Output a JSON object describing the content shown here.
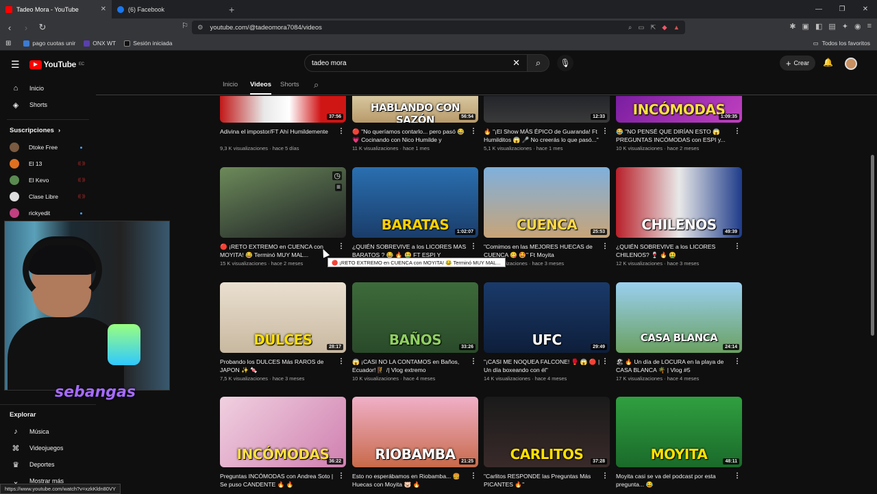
{
  "browser": {
    "tabs": [
      {
        "title": "Tadeo Mora - YouTube",
        "fav_color": "#ff0000",
        "active": true
      },
      {
        "title": "(6) Facebook",
        "fav_color": "#1877f2",
        "active": false
      }
    ],
    "url": "youtube.com/@tadeomora7084/videos",
    "bookmarks": [
      {
        "label": "pago cuotas unir"
      },
      {
        "label": "ONX WT"
      },
      {
        "label": "Sesión iniciada"
      }
    ],
    "favorites_label": "Todos los favoritos",
    "status_url": "https://www.youtube.com/watch?v=xzkKldn80VY"
  },
  "header": {
    "logo_text": "YouTube",
    "logo_region": "EC",
    "search_value": "tadeo mora",
    "create_label": "Crear"
  },
  "sidebar": {
    "top": [
      {
        "label": "Inicio",
        "icon": "home-icon",
        "glyph": "⌂"
      },
      {
        "label": "Shorts",
        "icon": "shorts-icon",
        "glyph": "◈"
      }
    ],
    "subs_heading": "Suscripciones",
    "subs": [
      {
        "label": "Dtoke Free",
        "color": "#7a5a40",
        "status": "dot"
      },
      {
        "label": "El 13",
        "color": "#e07020",
        "status": "live"
      },
      {
        "label": "El Kevo",
        "color": "#5a8a50",
        "status": "live"
      },
      {
        "label": "Clase Libre",
        "color": "#dddddd",
        "status": "live"
      },
      {
        "label": "rickyedit",
        "color": "#c04080",
        "status": "dot"
      }
    ],
    "explore_heading": "Explorar",
    "explore": [
      {
        "label": "Música",
        "icon": "music-icon",
        "glyph": "♪"
      },
      {
        "label": "Videojuegos",
        "icon": "gamepad-icon",
        "glyph": "⌘"
      },
      {
        "label": "Deportes",
        "icon": "trophy-icon",
        "glyph": "♛"
      },
      {
        "label": "Mostrar más",
        "icon": "chevron-down-icon",
        "glyph": "⌄"
      }
    ]
  },
  "channel_tabs": [
    "Inicio",
    "Videos",
    "Shorts"
  ],
  "selected_tab": "Videos",
  "overlay": {
    "streamer_tag": "sebangas",
    "tooltip": "🔴 ¡RETO EXTREMO en CUENCA con MOYITA! 😂 Terminó MUY MAL..."
  },
  "videos": [
    {
      "title": "Adivina el impostor/FT Ahí Humildemente",
      "meta": "9,3 K visualizaciones · hace 5 días",
      "duration": "37:56",
      "bg": "linear-gradient(90deg,#c21818 0,#e8e8e8 35%,#fff 55%,#d01515 80%)",
      "overlay_text": "",
      "text_color": "#fff"
    },
    {
      "title": "🔴 \"No queríamos contarlo... pero pasó 😂 💗 Cocinando con Nico Humilde y habland...",
      "meta": "11 K visualizaciones · hace 1 mes",
      "duration": "56:54",
      "bg": "linear-gradient(180deg,#d7c7a0,#b89a6a)",
      "overlay_text": "HABLANDO CON SAZÓN",
      "text_color": "#ffffff"
    },
    {
      "title": "🔥 \"¡El Show MÁS ÉPICO de Guaranda! Ft Humilditos 😱 🎤 No creerás lo que pasó...\"",
      "meta": "5,1 K visualizaciones · hace 1 mes",
      "duration": "12:33",
      "bg": "linear-gradient(180deg,#23252a,#3a3a3a)",
      "overlay_text": "",
      "text_color": "#fff"
    },
    {
      "title": "😂 \"NO PENSÉ QUE DIRÍAN ESTO 😱 PREGUNTAS INCÓMODAS con ESPI y...",
      "meta": "10 K visualizaciones · hace 2 meses",
      "duration": "1:09:35",
      "bg": "linear-gradient(135deg,#7a1ea0,#c040c0)",
      "overlay_text": "INCÓMODAS",
      "text_color": "#ffe040"
    },
    {
      "title": "🔴 ¡RETO EXTREMO en CUENCA con MOYITA! 😂 Terminó MUY MAL...",
      "meta": "15 K visualizaciones · hace 2 meses",
      "duration": "",
      "bg": "linear-gradient(160deg,#6d8a5a,#3c4a3a 60%,#222)",
      "overlay_text": "",
      "text_color": "#fff"
    },
    {
      "title": "¿QUIÉN SOBREVIVE a los LICORES MAS BARATOS ? 😂 🔥 🤮 FT ESPI Y FALCONE",
      "meta": "12 K visualizaciones · hace 3 meses",
      "duration": "1:02:07",
      "bg": "linear-gradient(180deg,#2a6fb0,#1a3d6a)",
      "overlay_text": "BARATAS",
      "text_color": "#ffd000"
    },
    {
      "title": "\"Comimos en las MEJORES HUECAS de CUENCA 😋 🤩\" Ft Moyita",
      "meta": "9 K visualizaciones · hace 3 meses",
      "duration": "25:53",
      "bg": "linear-gradient(180deg,#7fb0dc,#c8a478)",
      "overlay_text": "CUENCA",
      "text_color": "#ffd84a"
    },
    {
      "title": "¿QUIÉN SOBREVIVE a los LICORES CHILENOS? 🍷 🔥 🤮",
      "meta": "12 K visualizaciones · hace 3 meses",
      "duration": "49:39",
      "bg": "linear-gradient(90deg,#b8202a,#e8e8e8 50%,#1f3c8a)",
      "overlay_text": "CHILENOS",
      "text_color": "#ffffff"
    },
    {
      "title": "Probando los DULCES Más RAROS de JAPON ✨ 🍬",
      "meta": "7,5 K visualizaciones · hace 3 meses",
      "duration": "28:17",
      "bg": "linear-gradient(180deg,#eae0d0,#c8b8a0)",
      "overlay_text": "DULCES",
      "text_color": "#ffe000"
    },
    {
      "title": "😱 ¡CASI NO LA CONTAMOS en Baños, Ecuador! 🧗 /| Vlog extremo",
      "meta": "10 K visualizaciones · hace 4 meses",
      "duration": "33:26",
      "bg": "linear-gradient(180deg,#3d6b3a,#2a4a2a)",
      "overlay_text": "BAÑOS",
      "text_color": "#90d060"
    },
    {
      "title": "\"¡CASI ME NOQUEA FALCONE! 🥊 😱 🔴 | Un día boxeando con él\"",
      "meta": "14 K visualizaciones · hace 4 meses",
      "duration": "29:49",
      "bg": "linear-gradient(180deg,#1a3a6a,#0e1e3a)",
      "overlay_text": "UFC",
      "text_color": "#ffffff"
    },
    {
      "title": "🏖 🔥 Un día de LOCURA en la playa de CASA BLANCA 🌴 | Vlog #5",
      "meta": "17 K visualizaciones · hace 4 meses",
      "duration": "24:14",
      "bg": "linear-gradient(180deg,#9ad0f0,#6aa060)",
      "overlay_text": "CASA BLANCA",
      "text_color": "#ffffff"
    },
    {
      "title": "Preguntas INCÓMODAS con Andrea Soto | Se puso CANDENTE 🔥 🔥",
      "meta": "",
      "duration": "36:22",
      "bg": "linear-gradient(135deg,#f0d0e0,#d080b0)",
      "overlay_text": "INCÓMODAS",
      "text_color": "#ffe040"
    },
    {
      "title": "Esto no esperábamos en Riobamba... 🍔 Huecas con Moyita 🐷 🔥",
      "meta": "",
      "duration": "21:25",
      "bg": "linear-gradient(180deg,#f0b0c8,#c86a4a)",
      "overlay_text": "RIOBAMBA",
      "text_color": "#ffffff"
    },
    {
      "title": "\"Carlitos RESPONDE las Preguntas Más PICANTES 🔥\"",
      "meta": "",
      "duration": "37:28",
      "bg": "linear-gradient(180deg,#1a1a1a,#3a2a2a)",
      "overlay_text": "CARLITOS",
      "text_color": "#ffe000"
    },
    {
      "title": "Moyita casi se va del podcast por esta pregunta... 😂",
      "meta": "",
      "duration": "48:11",
      "bg": "linear-gradient(180deg,#30a040,#1a6a2a)",
      "overlay_text": "MOYITA",
      "text_color": "#ffe000"
    }
  ]
}
